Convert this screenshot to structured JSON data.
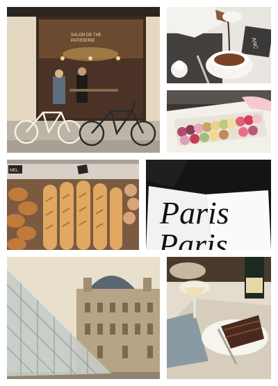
{
  "collage": {
    "tiles": [
      {
        "subject": "parisian-cafe-storefront-with-bicycles"
      },
      {
        "subject": "pouring-hot-chocolate"
      },
      {
        "subject": "box-of-macarons"
      },
      {
        "subject": "bakery-display-baguettes-croissants"
      },
      {
        "subject": "paris-magazine"
      },
      {
        "subject": "louvre-pyramid-and-palace"
      },
      {
        "subject": "chocolate-cake-and-champagne"
      }
    ]
  },
  "cafe": {
    "window_sign_line1": "SALON DE THE",
    "window_sign_line2": "PATISSERIE"
  },
  "hot_chocolate": {
    "menu_card_text": "ANC"
  },
  "bakery": {
    "price_tag_text": "MEL"
  },
  "magazine": {
    "title_line1": "Paris",
    "title_line2": "Paris"
  }
}
